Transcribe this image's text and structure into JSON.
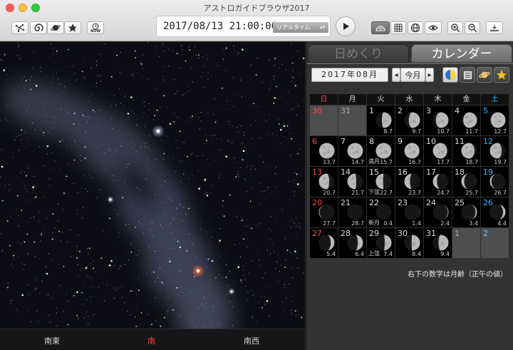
{
  "window": {
    "title": "アストロガイドブラウザ2017"
  },
  "toolbar": {
    "now_label": "NOW",
    "datetime": "2017/08/13 21:00:00",
    "time_mode": "リアルタイム"
  },
  "sky": {
    "directions": {
      "southeast": "南東",
      "south": "南",
      "southwest": "南西"
    },
    "direction_colors": {
      "south": "#ff4040"
    }
  },
  "panel": {
    "tabs": {
      "daily": "日めくり",
      "calendar": "カレンダー"
    },
    "month": "2017年08月",
    "this_month_label": "今月",
    "weekdays": [
      "日",
      "月",
      "火",
      "水",
      "木",
      "金",
      "土"
    ],
    "weekday_colors": {
      "sunday": "#ff4646",
      "saturday": "#38b6ff"
    },
    "weeks": [
      [
        {
          "day": "30",
          "other": true
        },
        {
          "day": "31",
          "other": true
        },
        {
          "day": "1",
          "age": "8.7",
          "illum": 0.62,
          "waxing": true
        },
        {
          "day": "2",
          "age": "9.7",
          "illum": 0.72,
          "waxing": true
        },
        {
          "day": "3",
          "age": "10.7",
          "illum": 0.81,
          "waxing": true
        },
        {
          "day": "4",
          "age": "11.7",
          "illum": 0.88,
          "waxing": true
        },
        {
          "day": "5",
          "age": "12.7",
          "illum": 0.94,
          "waxing": true
        }
      ],
      [
        {
          "day": "6",
          "age": "13.7",
          "illum": 0.98,
          "waxing": true
        },
        {
          "day": "7",
          "age": "14.7",
          "illum": 1.0,
          "waxing": true
        },
        {
          "day": "8",
          "age": "15.7",
          "phase": "満月",
          "illum": 0.99,
          "waxing": false
        },
        {
          "day": "9",
          "age": "16.7",
          "illum": 0.96,
          "waxing": false
        },
        {
          "day": "10",
          "age": "17.7",
          "illum": 0.91,
          "waxing": false
        },
        {
          "day": "11",
          "age": "18.7",
          "illum": 0.84,
          "waxing": false
        },
        {
          "day": "12",
          "age": "19.7",
          "illum": 0.76,
          "waxing": false
        }
      ],
      [
        {
          "day": "13",
          "age": "20.7",
          "illum": 0.67,
          "waxing": false
        },
        {
          "day": "14",
          "age": "21.7",
          "illum": 0.57,
          "waxing": false
        },
        {
          "day": "15",
          "age": "22.7",
          "phase": "下弦",
          "illum": 0.47,
          "waxing": false
        },
        {
          "day": "16",
          "age": "23.7",
          "illum": 0.37,
          "waxing": false
        },
        {
          "day": "17",
          "age": "24.7",
          "illum": 0.27,
          "waxing": false
        },
        {
          "day": "18",
          "age": "25.7",
          "illum": 0.19,
          "waxing": false
        },
        {
          "day": "19",
          "age": "26.7",
          "illum": 0.11,
          "waxing": false
        }
      ],
      [
        {
          "day": "20",
          "age": "27.7",
          "illum": 0.05,
          "waxing": false
        },
        {
          "day": "21",
          "age": "28.7",
          "illum": 0.01,
          "waxing": false
        },
        {
          "day": "22",
          "age": "0.4",
          "phase": "新月",
          "illum": 0.0,
          "waxing": true
        },
        {
          "day": "23",
          "age": "1.4",
          "illum": 0.02,
          "waxing": true
        },
        {
          "day": "24",
          "age": "2.4",
          "illum": 0.05,
          "waxing": true
        },
        {
          "day": "25",
          "age": "3.4",
          "illum": 0.1,
          "waxing": true
        },
        {
          "day": "26",
          "age": "4.4",
          "illum": 0.17,
          "waxing": true
        }
      ],
      [
        {
          "day": "27",
          "age": "5.4",
          "illum": 0.25,
          "waxing": true
        },
        {
          "day": "28",
          "age": "6.4",
          "illum": 0.34,
          "waxing": true
        },
        {
          "day": "29",
          "age": "7.4",
          "phase": "上弦",
          "illum": 0.44,
          "waxing": true
        },
        {
          "day": "30",
          "age": "8.4",
          "illum": 0.54,
          "waxing": true
        },
        {
          "day": "31",
          "age": "9.4",
          "illum": 0.64,
          "waxing": true
        },
        {
          "day": "1",
          "other": true
        },
        {
          "day": "2",
          "other": true
        }
      ]
    ],
    "footnote": "右下の数字は月齢（正午の値）"
  }
}
